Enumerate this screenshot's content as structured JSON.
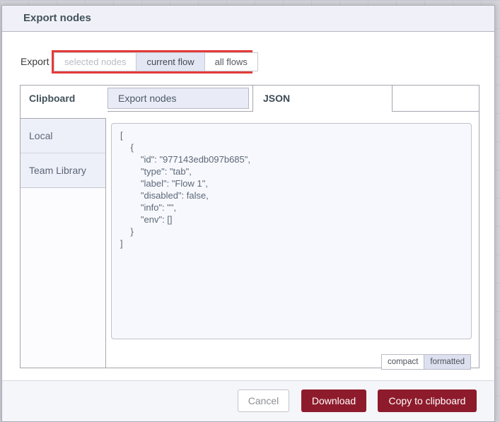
{
  "dialog": {
    "title": "Export nodes",
    "export_row": {
      "label": "Export",
      "options": {
        "selected_nodes": "selected nodes",
        "current_flow": "current flow",
        "all_flows": "all flows"
      },
      "selected_option": "current flow",
      "disabled_option": "selected nodes"
    },
    "panel": {
      "left_tab": "Clipboard",
      "tabs": {
        "export_nodes": "Export nodes",
        "json": "JSON"
      },
      "active_tab": "JSON",
      "sidebar": {
        "local": "Local",
        "team_library": "Team Library"
      },
      "code": "[\n    {\n        \"id\": \"977143edb097b685\",\n        \"type\": \"tab\",\n        \"label\": \"Flow 1\",\n        \"disabled\": false,\n        \"info\": \"\",\n        \"env\": []\n    }\n]",
      "format_buttons": {
        "compact": "compact",
        "formatted": "formatted"
      },
      "active_format": "formatted"
    },
    "footer": {
      "cancel": "Cancel",
      "download": "Download",
      "copy": "Copy to clipboard"
    }
  },
  "annotation": {
    "type": "highlight-box",
    "target": "export scope button group",
    "color": "#e23b3a"
  },
  "colors": {
    "primary_button": "#8e1b2c",
    "header_bg": "#f0f1f8",
    "inactive_tab_bg": "#e9ebf7",
    "sidebar_item_bg": "#eef0f9",
    "textarea_bg": "#f7f8fd",
    "title_text": "#42525b",
    "code_text": "#5d6877",
    "canvas_bg": "#d4d4d9"
  }
}
